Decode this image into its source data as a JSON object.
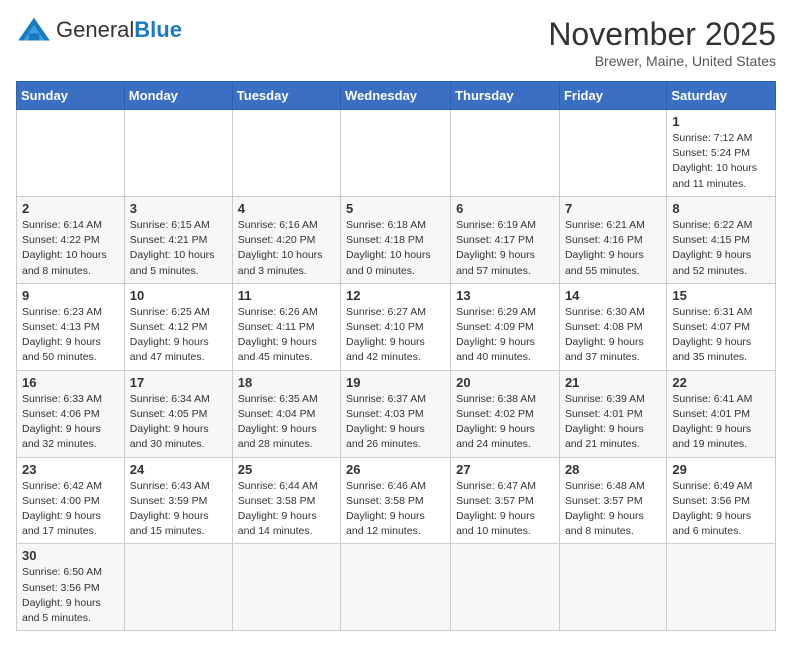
{
  "header": {
    "logo_general": "General",
    "logo_blue": "Blue",
    "month_title": "November 2025",
    "location": "Brewer, Maine, United States"
  },
  "days_of_week": [
    "Sunday",
    "Monday",
    "Tuesday",
    "Wednesday",
    "Thursday",
    "Friday",
    "Saturday"
  ],
  "weeks": [
    [
      {
        "day": "",
        "info": ""
      },
      {
        "day": "",
        "info": ""
      },
      {
        "day": "",
        "info": ""
      },
      {
        "day": "",
        "info": ""
      },
      {
        "day": "",
        "info": ""
      },
      {
        "day": "",
        "info": ""
      },
      {
        "day": "1",
        "info": "Sunrise: 7:12 AM\nSunset: 5:24 PM\nDaylight: 10 hours and 11 minutes."
      }
    ],
    [
      {
        "day": "2",
        "info": "Sunrise: 6:14 AM\nSunset: 4:22 PM\nDaylight: 10 hours and 8 minutes."
      },
      {
        "day": "3",
        "info": "Sunrise: 6:15 AM\nSunset: 4:21 PM\nDaylight: 10 hours and 5 minutes."
      },
      {
        "day": "4",
        "info": "Sunrise: 6:16 AM\nSunset: 4:20 PM\nDaylight: 10 hours and 3 minutes."
      },
      {
        "day": "5",
        "info": "Sunrise: 6:18 AM\nSunset: 4:18 PM\nDaylight: 10 hours and 0 minutes."
      },
      {
        "day": "6",
        "info": "Sunrise: 6:19 AM\nSunset: 4:17 PM\nDaylight: 9 hours and 57 minutes."
      },
      {
        "day": "7",
        "info": "Sunrise: 6:21 AM\nSunset: 4:16 PM\nDaylight: 9 hours and 55 minutes."
      },
      {
        "day": "8",
        "info": "Sunrise: 6:22 AM\nSunset: 4:15 PM\nDaylight: 9 hours and 52 minutes."
      }
    ],
    [
      {
        "day": "9",
        "info": "Sunrise: 6:23 AM\nSunset: 4:13 PM\nDaylight: 9 hours and 50 minutes."
      },
      {
        "day": "10",
        "info": "Sunrise: 6:25 AM\nSunset: 4:12 PM\nDaylight: 9 hours and 47 minutes."
      },
      {
        "day": "11",
        "info": "Sunrise: 6:26 AM\nSunset: 4:11 PM\nDaylight: 9 hours and 45 minutes."
      },
      {
        "day": "12",
        "info": "Sunrise: 6:27 AM\nSunset: 4:10 PM\nDaylight: 9 hours and 42 minutes."
      },
      {
        "day": "13",
        "info": "Sunrise: 6:29 AM\nSunset: 4:09 PM\nDaylight: 9 hours and 40 minutes."
      },
      {
        "day": "14",
        "info": "Sunrise: 6:30 AM\nSunset: 4:08 PM\nDaylight: 9 hours and 37 minutes."
      },
      {
        "day": "15",
        "info": "Sunrise: 6:31 AM\nSunset: 4:07 PM\nDaylight: 9 hours and 35 minutes."
      }
    ],
    [
      {
        "day": "16",
        "info": "Sunrise: 6:33 AM\nSunset: 4:06 PM\nDaylight: 9 hours and 32 minutes."
      },
      {
        "day": "17",
        "info": "Sunrise: 6:34 AM\nSunset: 4:05 PM\nDaylight: 9 hours and 30 minutes."
      },
      {
        "day": "18",
        "info": "Sunrise: 6:35 AM\nSunset: 4:04 PM\nDaylight: 9 hours and 28 minutes."
      },
      {
        "day": "19",
        "info": "Sunrise: 6:37 AM\nSunset: 4:03 PM\nDaylight: 9 hours and 26 minutes."
      },
      {
        "day": "20",
        "info": "Sunrise: 6:38 AM\nSunset: 4:02 PM\nDaylight: 9 hours and 24 minutes."
      },
      {
        "day": "21",
        "info": "Sunrise: 6:39 AM\nSunset: 4:01 PM\nDaylight: 9 hours and 21 minutes."
      },
      {
        "day": "22",
        "info": "Sunrise: 6:41 AM\nSunset: 4:01 PM\nDaylight: 9 hours and 19 minutes."
      }
    ],
    [
      {
        "day": "23",
        "info": "Sunrise: 6:42 AM\nSunset: 4:00 PM\nDaylight: 9 hours and 17 minutes."
      },
      {
        "day": "24",
        "info": "Sunrise: 6:43 AM\nSunset: 3:59 PM\nDaylight: 9 hours and 15 minutes."
      },
      {
        "day": "25",
        "info": "Sunrise: 6:44 AM\nSunset: 3:58 PM\nDaylight: 9 hours and 14 minutes."
      },
      {
        "day": "26",
        "info": "Sunrise: 6:46 AM\nSunset: 3:58 PM\nDaylight: 9 hours and 12 minutes."
      },
      {
        "day": "27",
        "info": "Sunrise: 6:47 AM\nSunset: 3:57 PM\nDaylight: 9 hours and 10 minutes."
      },
      {
        "day": "28",
        "info": "Sunrise: 6:48 AM\nSunset: 3:57 PM\nDaylight: 9 hours and 8 minutes."
      },
      {
        "day": "29",
        "info": "Sunrise: 6:49 AM\nSunset: 3:56 PM\nDaylight: 9 hours and 6 minutes."
      }
    ],
    [
      {
        "day": "30",
        "info": "Sunrise: 6:50 AM\nSunset: 3:56 PM\nDaylight: 9 hours and 5 minutes."
      },
      {
        "day": "",
        "info": ""
      },
      {
        "day": "",
        "info": ""
      },
      {
        "day": "",
        "info": ""
      },
      {
        "day": "",
        "info": ""
      },
      {
        "day": "",
        "info": ""
      },
      {
        "day": "",
        "info": ""
      }
    ]
  ]
}
